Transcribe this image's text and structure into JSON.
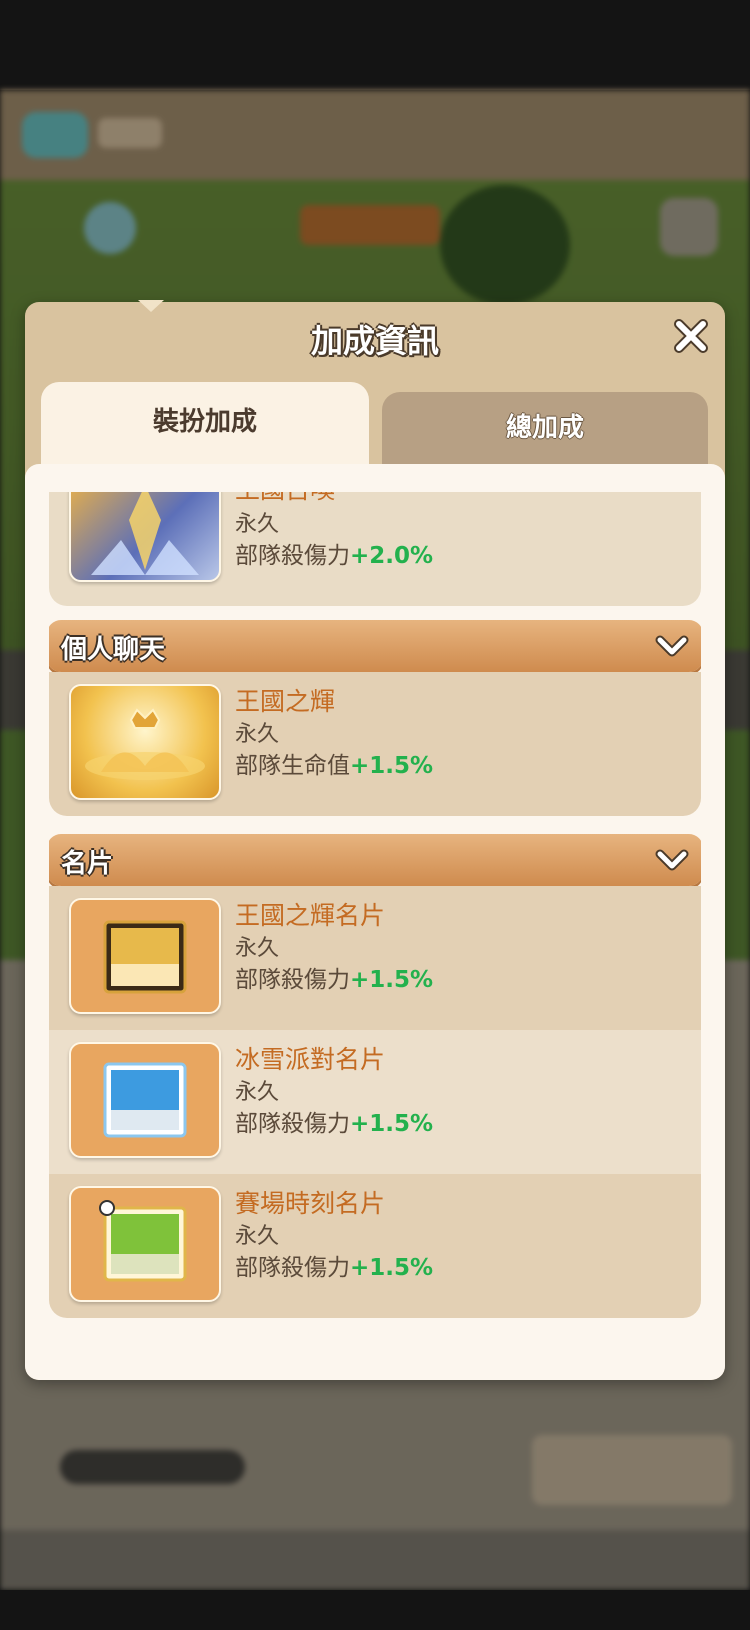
{
  "modal": {
    "title": "加成資訊",
    "close_icon": "close-x-icon",
    "tabs": [
      {
        "label": "裝扮加成",
        "active": true
      },
      {
        "label": "總加成",
        "active": false
      }
    ]
  },
  "top_item": {
    "name": "王國召喚",
    "duration": "永久",
    "stat_label": "部隊殺傷力",
    "stat_value": "+2.0%"
  },
  "sections": [
    {
      "title": "個人聊天",
      "items": [
        {
          "name": "王國之輝",
          "duration": "永久",
          "stat_label": "部隊生命值",
          "stat_value": "+1.5%"
        }
      ]
    },
    {
      "title": "名片",
      "items": [
        {
          "name": "王國之輝名片",
          "duration": "永久",
          "stat_label": "部隊殺傷力",
          "stat_value": "+1.5%"
        },
        {
          "name": "冰雪派對名片",
          "duration": "永久",
          "stat_label": "部隊殺傷力",
          "stat_value": "+1.5%"
        },
        {
          "name": "賽場時刻名片",
          "duration": "永久",
          "stat_label": "部隊殺傷力",
          "stat_value": "+1.5%"
        }
      ]
    }
  ],
  "colors": {
    "accent_orange": "#c46b22",
    "bonus_green": "#23b14d",
    "header_tan": "#d9c39f"
  }
}
